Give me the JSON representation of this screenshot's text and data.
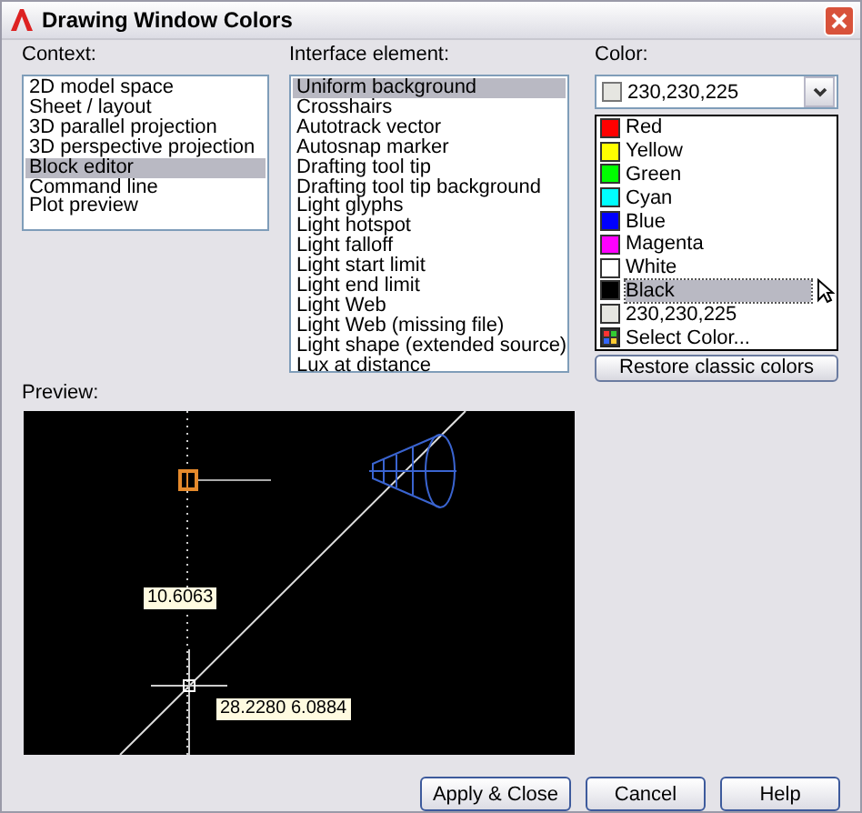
{
  "window": {
    "title": "Drawing Window Colors"
  },
  "context": {
    "label": "Context:",
    "items": [
      {
        "label": "2D model space",
        "selected": false
      },
      {
        "label": "Sheet / layout",
        "selected": false
      },
      {
        "label": "3D parallel projection",
        "selected": false
      },
      {
        "label": "3D perspective projection",
        "selected": false
      },
      {
        "label": "Block editor",
        "selected": true
      },
      {
        "label": "Command line",
        "selected": false
      },
      {
        "label": "Plot preview",
        "selected": false
      }
    ]
  },
  "interface_element": {
    "label": "Interface element:",
    "items": [
      {
        "label": "Uniform background",
        "selected": true
      },
      {
        "label": "Crosshairs",
        "selected": false
      },
      {
        "label": "Autotrack vector",
        "selected": false
      },
      {
        "label": "Autosnap marker",
        "selected": false
      },
      {
        "label": "Drafting tool tip",
        "selected": false
      },
      {
        "label": "Drafting tool tip background",
        "selected": false
      },
      {
        "label": "Light glyphs",
        "selected": false
      },
      {
        "label": "Light hotspot",
        "selected": false
      },
      {
        "label": "Light falloff",
        "selected": false
      },
      {
        "label": "Light start limit",
        "selected": false
      },
      {
        "label": "Light end limit",
        "selected": false
      },
      {
        "label": "Light Web",
        "selected": false
      },
      {
        "label": "Light Web (missing file)",
        "selected": false
      },
      {
        "label": "Light shape (extended source)",
        "selected": false
      },
      {
        "label": "Lux at distance",
        "selected": false
      }
    ]
  },
  "color": {
    "label": "Color:",
    "value": {
      "text": "230,230,225",
      "color": "#e6e6e1"
    },
    "options": [
      {
        "kind": "swatch",
        "label": "Red",
        "color": "#ff0000",
        "selected": false
      },
      {
        "kind": "swatch",
        "label": "Yellow",
        "color": "#ffff00",
        "selected": false
      },
      {
        "kind": "swatch",
        "label": "Green",
        "color": "#00ff00",
        "selected": false
      },
      {
        "kind": "swatch",
        "label": "Cyan",
        "color": "#00ffff",
        "selected": false
      },
      {
        "kind": "swatch",
        "label": "Blue",
        "color": "#0000ff",
        "selected": false
      },
      {
        "kind": "swatch",
        "label": "Magenta",
        "color": "#ff00ff",
        "selected": false
      },
      {
        "kind": "swatch",
        "label": "White",
        "color": "#ffffff",
        "selected": false
      },
      {
        "kind": "swatch",
        "label": "Black",
        "color": "#000000",
        "selected": true
      },
      {
        "kind": "swatch",
        "label": "230,230,225",
        "color": "#e6e6e1",
        "selected": false
      },
      {
        "kind": "picker",
        "label": "Select Color...",
        "selected": false
      }
    ],
    "restore_button": "Restore classic colors"
  },
  "preview": {
    "label": "Preview:",
    "readouts": [
      "10.6063",
      "28.2280",
      "6.0884"
    ]
  },
  "buttons": [
    "Apply & Close",
    "Cancel",
    "Help"
  ]
}
